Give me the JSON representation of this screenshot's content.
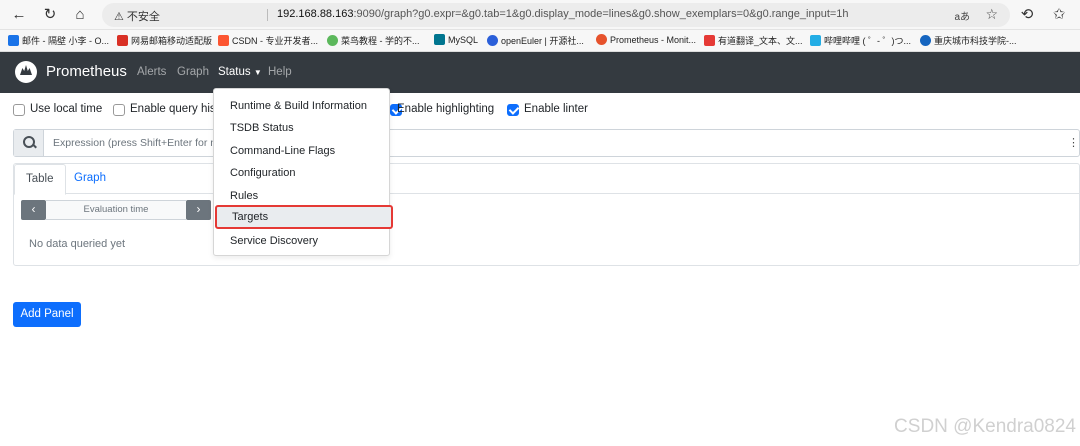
{
  "browser": {
    "security_label": "不安全",
    "url_host": "192.168.88.163",
    "url_rest": ":9090/graph?g0.expr=&g0.tab=1&g0.display_mode=lines&g0.show_exemplars=0&g0.range_input=1h",
    "read_aloud": "aあ",
    "bookmarks": [
      {
        "label": "邮件 - 隔壁 小李 - O...",
        "color": "#1a73e8"
      },
      {
        "label": "网易邮箱移动适配版",
        "color": "#d93025"
      },
      {
        "label": "CSDN - 专业开发者...",
        "color": "#fc5531"
      },
      {
        "label": "菜鸟教程 - 学的不...",
        "color": "#5cb85c"
      },
      {
        "label": "MySQL",
        "color": "#00758f"
      },
      {
        "label": "openEuler | 开源社...",
        "color": "#2b5fd9"
      },
      {
        "label": "Prometheus - Monit...",
        "color": "#e6522c"
      },
      {
        "label": "有道翻译_文本、文...",
        "color": "#e53935"
      },
      {
        "label": "哔哩哔哩 ( ゜- ゜)つ...",
        "color": "#23ade5"
      },
      {
        "label": "重庆城市科技学院-...",
        "color": "#1565c0"
      }
    ]
  },
  "nav": {
    "brand": "Prometheus",
    "alerts": "Alerts",
    "graph": "Graph",
    "status": "Status",
    "help": "Help"
  },
  "options": {
    "use_local_time": "Use local time",
    "enable_query_history": "Enable query hist",
    "enable_highlighting": "Enable highlighting",
    "enable_linter": "Enable linter"
  },
  "expression": {
    "placeholder": "Expression (press Shift+Enter for ne"
  },
  "panel": {
    "tab_table": "Table",
    "tab_graph": "Graph",
    "evaluation_time": "Evaluation time",
    "prev": "‹",
    "next": "›",
    "no_data": "No data queried yet"
  },
  "add_panel": "Add Panel",
  "status_menu": {
    "items": [
      "Runtime & Build Information",
      "TSDB Status",
      "Command-Line Flags",
      "Configuration",
      "Rules",
      "Targets",
      "Service Discovery"
    ],
    "highlighted": "Targets"
  },
  "watermark": "CSDN @Kendra0824"
}
